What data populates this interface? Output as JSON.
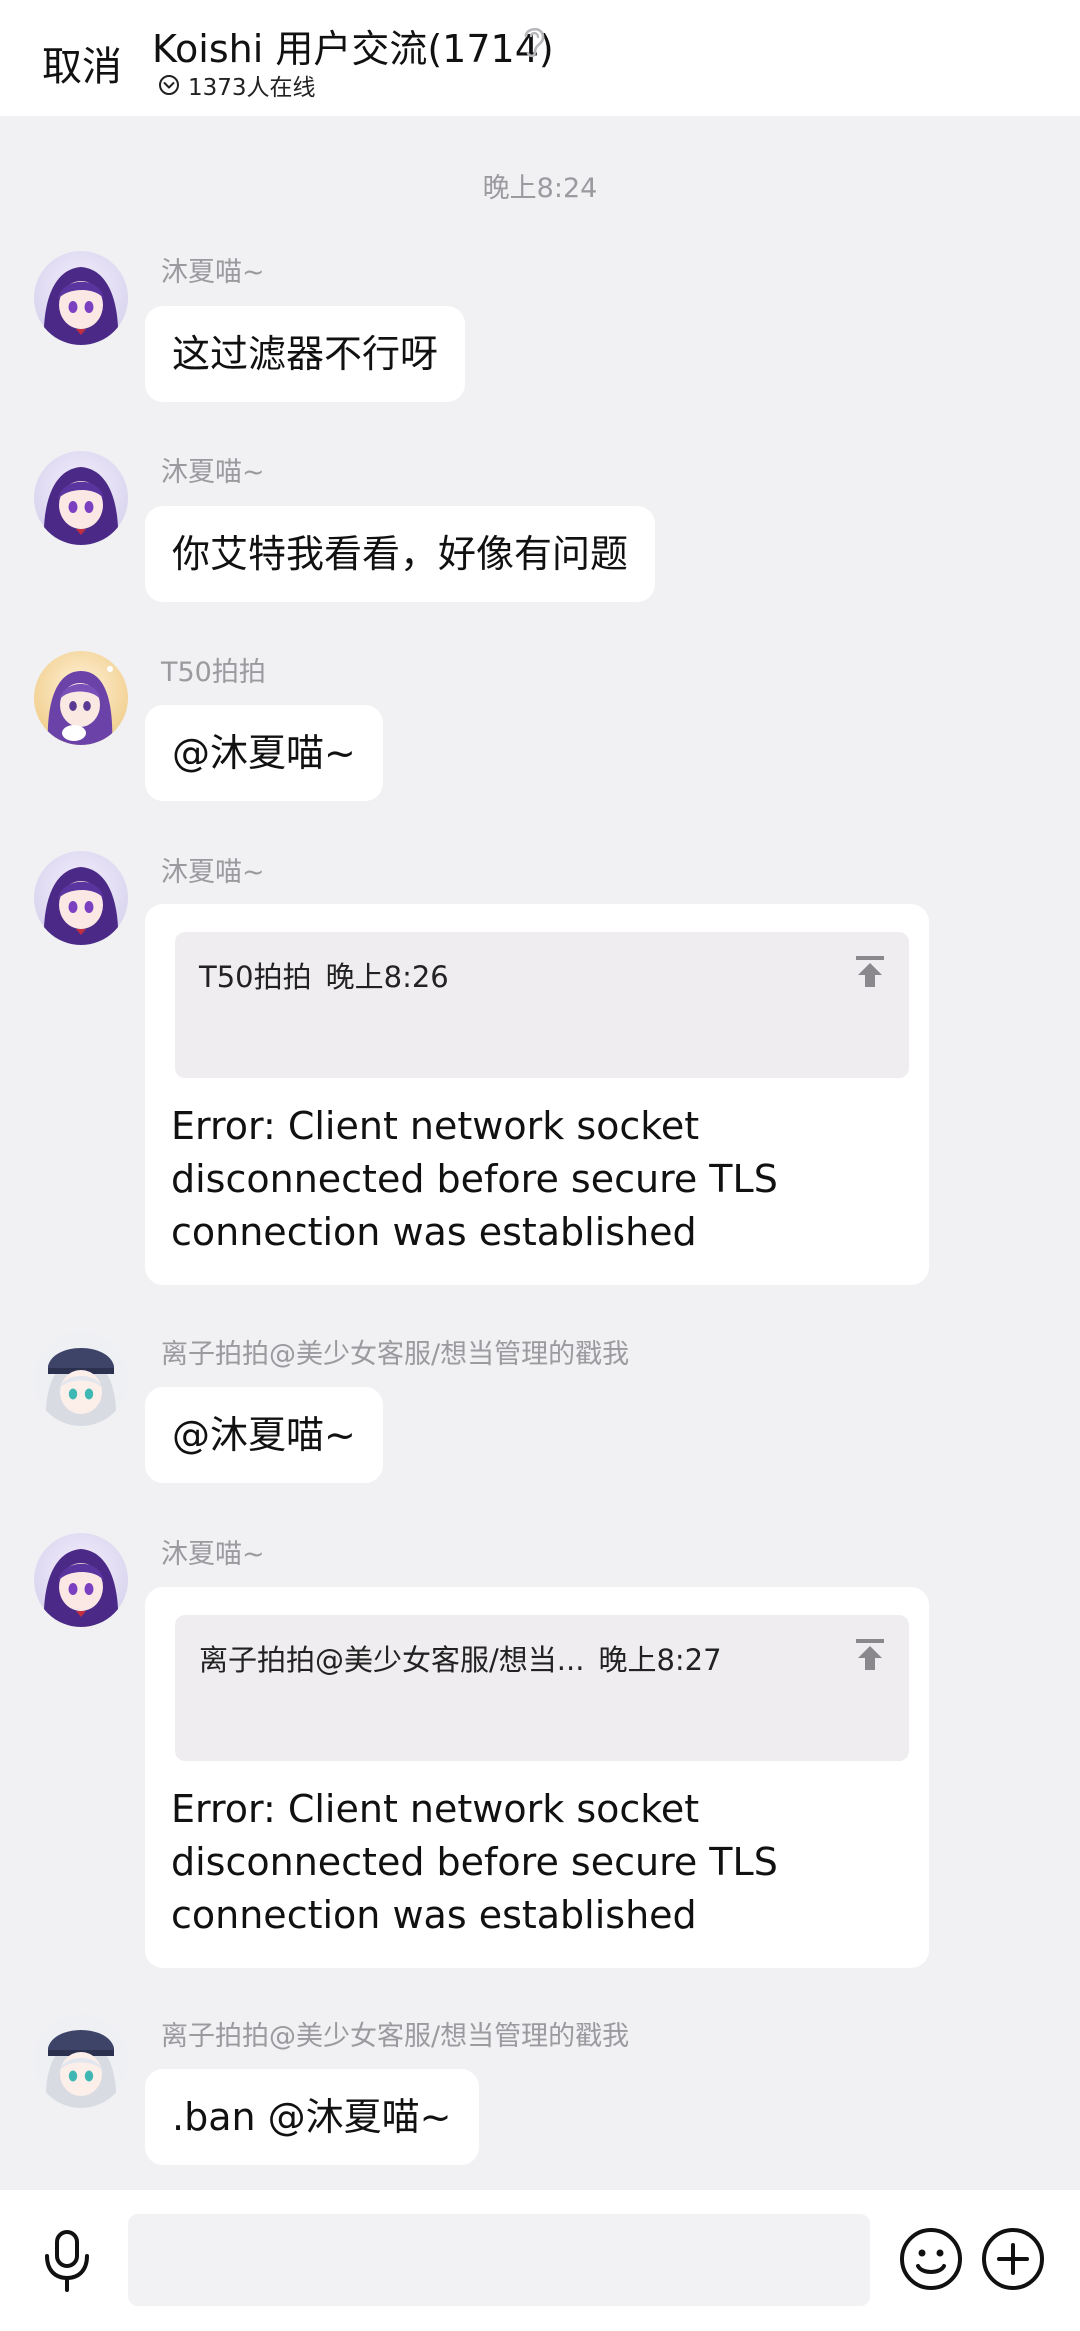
{
  "header": {
    "cancel_label": "取消",
    "title": "Koishi 用户交流(1714)",
    "online_text": "1373人在线"
  },
  "timestamp": "晚上8:24",
  "messages": [
    {
      "sender": "沐夏喵~",
      "text": "这过滤器不行呀",
      "avatar": "purple-hair-avatar"
    },
    {
      "sender": "沐夏喵~",
      "text": "你艾特我看看，好像有问题",
      "avatar": "purple-hair-avatar"
    },
    {
      "sender": "T50拍拍",
      "text": "@沐夏喵~",
      "avatar": "blonde-avatar"
    },
    {
      "sender": "沐夏喵~",
      "avatar": "purple-hair-avatar",
      "quote": {
        "sender": "T50拍拍",
        "time": "晚上8:26"
      },
      "text": "Error: Client network socket disconnected before secure TLS connection was established"
    },
    {
      "sender": "离子拍拍@美少女客服/想当管理的戳我",
      "text": "@沐夏喵~",
      "avatar": "silver-hair-avatar"
    },
    {
      "sender": "沐夏喵~",
      "avatar": "purple-hair-avatar",
      "quote": {
        "sender": "离子拍拍@美少女客服/想当...",
        "time": "晚上8:27"
      },
      "text": "Error: Client network socket disconnected before secure TLS connection was established"
    },
    {
      "sender": "离子拍拍@美少女客服/想当管理的戳我",
      "text": ".ban @沐夏喵~",
      "avatar": "silver-hair-avatar"
    }
  ],
  "input": {
    "placeholder": ""
  },
  "icons": {
    "voice": "microphone-icon",
    "emoji": "emoji-icon",
    "more": "plus-icon",
    "ear": "ear-icon"
  },
  "colors": {
    "background": "#f1f1f3",
    "bubble": "#ffffff",
    "quote": "#efedf0",
    "meta": "#9a9a9f"
  }
}
